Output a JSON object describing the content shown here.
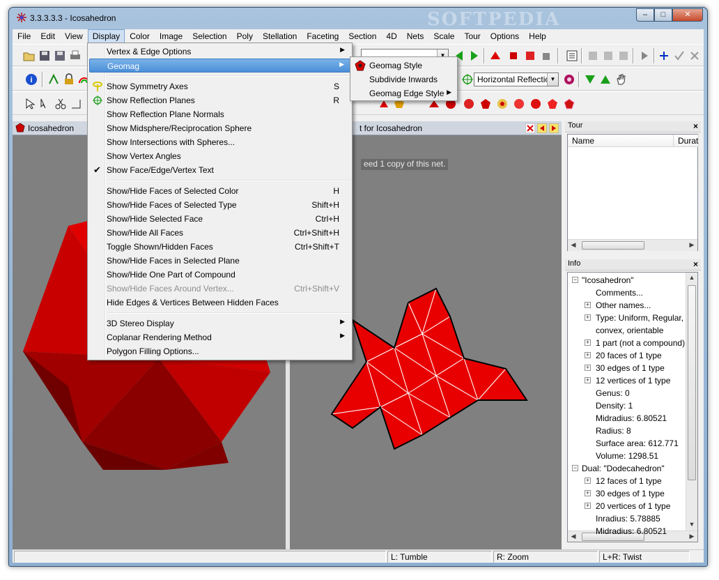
{
  "window": {
    "title": "3.3.3.3.3 - Icosahedron",
    "watermark": "SOFTPEDIA",
    "minimize": "–",
    "maximize": "□",
    "close": "✕"
  },
  "menubar": [
    "File",
    "Edit",
    "View",
    "Display",
    "Color",
    "Image",
    "Selection",
    "Poly",
    "Stellation",
    "Faceting",
    "Section",
    "4D",
    "Nets",
    "Scale",
    "Tour",
    "Options",
    "Help"
  ],
  "toolbar": {
    "reflection_combo": "Horizontal Reflection"
  },
  "panes": {
    "left_title": "Icosahedron",
    "net_title": "t for Icosahedron",
    "net_tooltip": "eed 1 copy of this net."
  },
  "tour": {
    "title": "Tour",
    "columns": [
      "Name",
      "Durat"
    ]
  },
  "info": {
    "title": "Info",
    "rows": [
      {
        "text": "\"Icosahedron\"",
        "expander": "minus",
        "level": 0
      },
      {
        "text": "Comments...",
        "expander": "none",
        "level": 1
      },
      {
        "text": "Other names...",
        "expander": "plus",
        "level": 1
      },
      {
        "text": "Type: Uniform, Regular,",
        "expander": "plus",
        "level": 1
      },
      {
        "text": "convex, orientable",
        "expander": "none",
        "level": 1
      },
      {
        "text": "1 part (not a compound)",
        "expander": "plus",
        "level": 1
      },
      {
        "text": "20 faces of 1 type",
        "expander": "plus",
        "level": 1
      },
      {
        "text": "30 edges of 1 type",
        "expander": "plus",
        "level": 1
      },
      {
        "text": "12 vertices of 1 type",
        "expander": "plus",
        "level": 1
      },
      {
        "text": "Genus: 0",
        "expander": "none",
        "level": 1
      },
      {
        "text": "Density: 1",
        "expander": "none",
        "level": 1
      },
      {
        "text": "Midradius: 6.80521",
        "expander": "none",
        "level": 1
      },
      {
        "text": "Radius: 8",
        "expander": "none",
        "level": 1
      },
      {
        "text": "Surface area: 612.771",
        "expander": "none",
        "level": 1
      },
      {
        "text": "Volume: 1298.51",
        "expander": "none",
        "level": 1
      },
      {
        "text": "Dual: \"Dodecahedron\"",
        "expander": "minus",
        "level": 0
      },
      {
        "text": "12 faces of 1 type",
        "expander": "plus",
        "level": 1
      },
      {
        "text": "30 edges of 1 type",
        "expander": "plus",
        "level": 1
      },
      {
        "text": "20 vertices of 1 type",
        "expander": "plus",
        "level": 1
      },
      {
        "text": "Inradius: 5.78885",
        "expander": "none",
        "level": 1
      },
      {
        "text": "Midradius: 6.80521",
        "expander": "none",
        "level": 1
      }
    ]
  },
  "display_menu": {
    "items": [
      {
        "label": "Vertex & Edge Options",
        "shortcut": "",
        "submenu": true
      },
      {
        "label": "Geomag",
        "shortcut": "",
        "submenu": true,
        "highlight": true
      },
      {
        "separator": true
      },
      {
        "label": "Show Symmetry Axes",
        "shortcut": "S",
        "icon": "symmetry-axes-icon"
      },
      {
        "label": "Show Reflection Planes",
        "shortcut": "R",
        "icon": "reflection-planes-icon"
      },
      {
        "label": "Show Reflection Plane Normals",
        "shortcut": ""
      },
      {
        "label": "Show Midsphere/Reciprocation Sphere",
        "shortcut": ""
      },
      {
        "label": "Show Intersections with Spheres...",
        "shortcut": ""
      },
      {
        "label": "Show Vertex Angles",
        "shortcut": ""
      },
      {
        "label": "Show Face/Edge/Vertex Text",
        "shortcut": "",
        "checked": true
      },
      {
        "separator": true
      },
      {
        "label": "Show/Hide Faces of Selected Color",
        "shortcut": "H"
      },
      {
        "label": "Show/Hide Faces of Selected Type",
        "shortcut": "Shift+H"
      },
      {
        "label": "Show/Hide Selected Face",
        "shortcut": "Ctrl+H"
      },
      {
        "label": "Show/Hide All Faces",
        "shortcut": "Ctrl+Shift+H"
      },
      {
        "label": "Toggle Shown/Hidden Faces",
        "shortcut": "Ctrl+Shift+T"
      },
      {
        "label": "Show/Hide Faces in Selected Plane",
        "shortcut": ""
      },
      {
        "label": "Show/Hide One Part of Compound",
        "shortcut": ""
      },
      {
        "label": "Show/Hide Faces Around Vertex...",
        "shortcut": "Ctrl+Shift+V",
        "disabled": true
      },
      {
        "label": "Hide Edges & Vertices Between Hidden Faces",
        "shortcut": ""
      },
      {
        "separator": true
      },
      {
        "label": "3D Stereo Display",
        "shortcut": "",
        "submenu": true
      },
      {
        "label": "Coplanar Rendering Method",
        "shortcut": "",
        "submenu": true
      },
      {
        "label": "Polygon Filling Options...",
        "shortcut": ""
      }
    ]
  },
  "geomag_submenu": [
    {
      "label": "Geomag Style",
      "submenu": false,
      "icon": "geomag-style-icon"
    },
    {
      "label": "Subdivide Inwards",
      "submenu": false
    },
    {
      "label": "Geomag Edge Style",
      "submenu": true
    }
  ],
  "status": {
    "left": "",
    "tumble": "L: Tumble",
    "zoom": "R: Zoom",
    "twist": "L+R: Twist"
  },
  "colors": {
    "face_red": "#e80000",
    "dark_red": "#7a0000",
    "viewport_gray": "#808080",
    "menu_highlight": "#4a8fd8"
  }
}
